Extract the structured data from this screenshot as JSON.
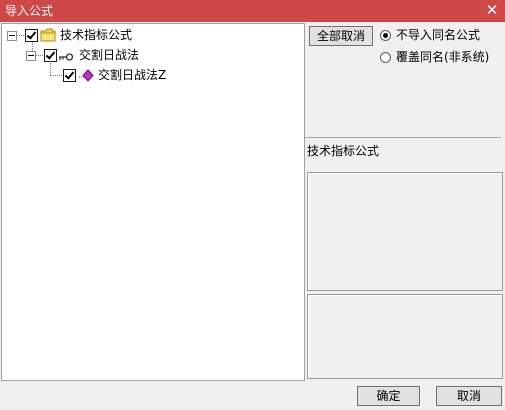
{
  "window": {
    "title": "导入公式",
    "close_glyph": "✕",
    "title_bar_color": "#cf4848"
  },
  "tree": {
    "root": {
      "label": "技术指标公式",
      "icon": "folder-icon",
      "checked": true,
      "expanded": true
    },
    "child": {
      "label": "交割日战法",
      "icon": "key-icon",
      "checked": true,
      "expanded": true
    },
    "leaf": {
      "label": "交割日战法Z",
      "icon": "formula-diamond-icon",
      "checked": true
    }
  },
  "options": {
    "deselect_all_label": "全部取消",
    "radio_options": [
      {
        "label": "不导入同名公式",
        "selected": true
      },
      {
        "label": "覆盖同名(非系统)",
        "selected": false
      }
    ]
  },
  "info": {
    "category_label": "技术指标公式"
  },
  "footer": {
    "ok_label": "确定",
    "cancel_label": "取消"
  }
}
